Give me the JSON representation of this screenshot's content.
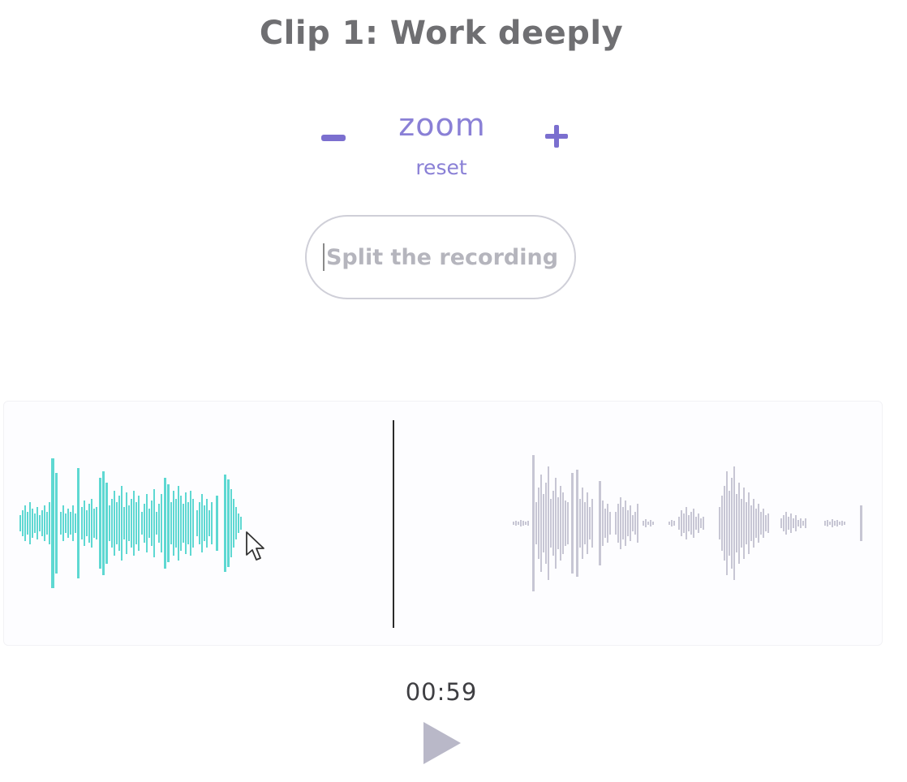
{
  "clip": {
    "title": "Clip 1: Work deeply"
  },
  "zoom": {
    "label": "zoom",
    "reset_label": "reset",
    "minus_icon": "minus-icon",
    "plus_icon": "plus-icon"
  },
  "split": {
    "label": "Split the recording"
  },
  "player": {
    "time": "00:59",
    "play_icon": "play-icon"
  },
  "colors": {
    "accent": "#7b6fcf",
    "played_wave": "#5ed8d2",
    "unplayed_wave": "#c7c6d4",
    "split_marker": "#2a2a2a"
  }
}
